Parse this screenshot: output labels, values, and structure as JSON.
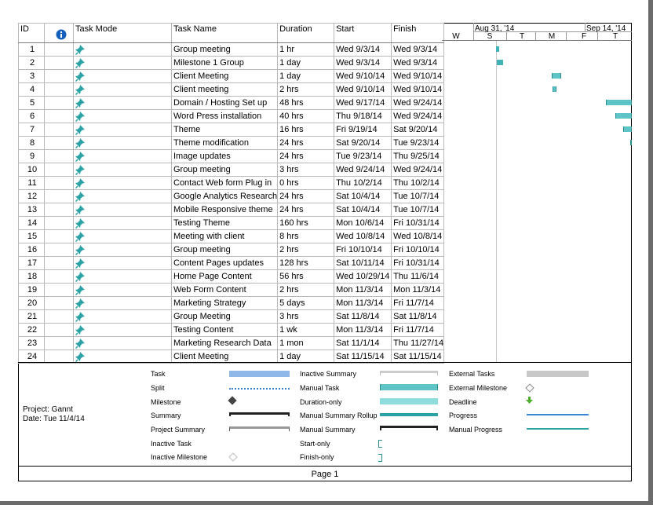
{
  "columns": {
    "id": "ID",
    "task_mode": "Task Mode",
    "task_name": "Task Name",
    "duration": "Duration",
    "start": "Start",
    "finish": "Finish"
  },
  "timescale": {
    "weeks": [
      "Aug 31, '14",
      "Sep 14, '14"
    ],
    "days": [
      "W",
      "S",
      "T",
      "M",
      "F",
      "T"
    ]
  },
  "tasks": [
    {
      "id": "1",
      "name": "Group meeting",
      "duration": "1 hr",
      "start": "Wed 9/3/14",
      "finish": "Wed 9/3/14"
    },
    {
      "id": "2",
      "name": "Milestone 1 Group",
      "duration": "1 day",
      "start": "Wed 9/3/14",
      "finish": "Wed 9/3/14"
    },
    {
      "id": "3",
      "name": "Client Meeting",
      "duration": "1 day",
      "start": "Wed 9/10/14",
      "finish": "Wed 9/10/14"
    },
    {
      "id": "4",
      "name": "Client meeting",
      "duration": "2 hrs",
      "start": "Wed 9/10/14",
      "finish": "Wed 9/10/14"
    },
    {
      "id": "5",
      "name": "Domain / Hosting Set up",
      "duration": "48 hrs",
      "start": "Wed 9/17/14",
      "finish": "Wed 9/24/14"
    },
    {
      "id": "6",
      "name": "Word Press installation",
      "duration": "40 hrs",
      "start": "Thu 9/18/14",
      "finish": "Wed 9/24/14"
    },
    {
      "id": "7",
      "name": "Theme",
      "duration": "16 hrs",
      "start": "Fri 9/19/14",
      "finish": "Sat 9/20/14"
    },
    {
      "id": "8",
      "name": "Theme modification",
      "duration": "24 hrs",
      "start": "Sat 9/20/14",
      "finish": "Tue 9/23/14"
    },
    {
      "id": "9",
      "name": "Image updates",
      "duration": "24 hrs",
      "start": "Tue 9/23/14",
      "finish": "Thu 9/25/14"
    },
    {
      "id": "10",
      "name": "Group meeting",
      "duration": "3 hrs",
      "start": "Wed 9/24/14",
      "finish": "Wed 9/24/14"
    },
    {
      "id": "11",
      "name": "Contact Web form Plug in",
      "duration": "0 hrs",
      "start": "Thu 10/2/14",
      "finish": "Thu 10/2/14"
    },
    {
      "id": "12",
      "name": "Google Analytics Research",
      "duration": "24 hrs",
      "start": "Sat 10/4/14",
      "finish": "Tue 10/7/14"
    },
    {
      "id": "13",
      "name": "Mobile Responsive theme",
      "duration": "24 hrs",
      "start": "Sat 10/4/14",
      "finish": "Tue 10/7/14"
    },
    {
      "id": "14",
      "name": "Testing Theme",
      "duration": "160 hrs",
      "start": "Mon 10/6/14",
      "finish": "Fri 10/31/14"
    },
    {
      "id": "15",
      "name": "Meeting with client",
      "duration": "8 hrs",
      "start": "Wed 10/8/14",
      "finish": "Wed 10/8/14"
    },
    {
      "id": "16",
      "name": "Group meeting",
      "duration": "2 hrs",
      "start": "Fri 10/10/14",
      "finish": "Fri 10/10/14"
    },
    {
      "id": "17",
      "name": "Content Pages updates",
      "duration": "128 hrs",
      "start": "Sat 10/11/14",
      "finish": "Fri 10/31/14"
    },
    {
      "id": "18",
      "name": "Home Page Content",
      "duration": "56 hrs",
      "start": "Wed 10/29/14",
      "finish": "Thu 11/6/14"
    },
    {
      "id": "19",
      "name": "Web Form Content",
      "duration": "2 hrs",
      "start": "Mon 11/3/14",
      "finish": "Mon 11/3/14"
    },
    {
      "id": "20",
      "name": "Marketing Strategy",
      "duration": "5 days",
      "start": "Mon 11/3/14",
      "finish": "Fri 11/7/14"
    },
    {
      "id": "21",
      "name": "Group Meeting",
      "duration": "3 hrs",
      "start": "Sat 11/8/14",
      "finish": "Sat 11/8/14"
    },
    {
      "id": "22",
      "name": "Testing Content",
      "duration": "1 wk",
      "start": "Mon 11/3/14",
      "finish": "Fri 11/7/14"
    },
    {
      "id": "23",
      "name": "Marketing Research Data",
      "duration": "1 mon",
      "start": "Sat 11/1/14",
      "finish": "Thu 11/27/14"
    },
    {
      "id": "24",
      "name": "Client Meeting",
      "duration": "1 day",
      "start": "Sat 11/15/14",
      "finish": "Sat 11/15/14"
    }
  ],
  "legend": {
    "project": "Project: Gannt",
    "date": "Date: Tue 11/4/14",
    "col1": [
      "Task",
      "Split",
      "Milestone",
      "Summary",
      "Project Summary",
      "Inactive Task",
      "Inactive Milestone"
    ],
    "col2": [
      "Inactive Summary",
      "Manual Task",
      "Duration-only",
      "Manual Summary Rollup",
      "Manual Summary",
      "Start-only",
      "Finish-only"
    ],
    "col3": [
      "External Tasks",
      "External Milestone",
      "Deadline",
      "Progress",
      "Manual Progress"
    ]
  },
  "footer": "Page 1",
  "colors": {
    "manual_task": "#5ec4c6",
    "task": "#8fb8e8",
    "deadline": "#4caf2a",
    "progress": "#3a86d6"
  }
}
